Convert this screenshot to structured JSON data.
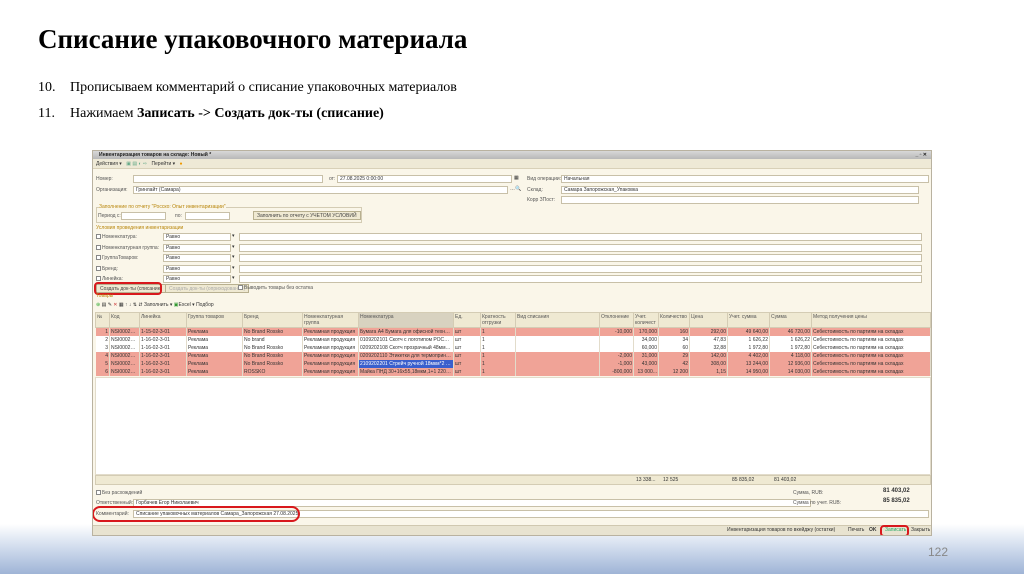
{
  "slide": {
    "title": "Списание упаковочного материала",
    "steps": [
      {
        "n": "10.",
        "text": "Прописываем комментарий о списание упаковочных материалов"
      },
      {
        "n": "11.",
        "pre": "Нажимаем ",
        "bold": "Записать -> Создать док-ты (списание)"
      }
    ],
    "page_number": "122"
  },
  "window": {
    "title": "Инвентаризация товаров на складе: Новый *",
    "toolbar": {
      "actions": "Действия",
      "goto": "Перейти"
    },
    "fields": {
      "number_label": "Номер:",
      "number_value": "",
      "date_label": "от:",
      "date_value": "27.08.2025 0:00:00",
      "org_label": "Организация:",
      "org_value": "Гринлайт (Самара)",
      "optype_label": "Вид операции:",
      "optype_value": "Начальная",
      "warehouse_label": "Склад:",
      "warehouse_value": "Самара Запорожская_Упаковка",
      "corr_label": "Корр ЗПост:",
      "corr_value": ""
    },
    "fill_group": {
      "title": "Заполнение по отчету \"Росско: Опыт инвентаризации\"",
      "period_from": "Период с:",
      "period_to": "по:",
      "fill_button": "Заполнить по отчету с УЧЕТОМ УСЛОВИЙ"
    },
    "conditions": {
      "title": "Условия проведения инвентаризации",
      "rows": [
        {
          "label": "Номенклатура:",
          "op": "Равно"
        },
        {
          "label": "Номенклатурная группа:",
          "op": "Равно"
        },
        {
          "label": "ГруппаТоваров:",
          "op": "Равно"
        },
        {
          "label": "Бренд:",
          "op": "Равно"
        },
        {
          "label": "Линейка:",
          "op": "Равно"
        }
      ]
    },
    "buttons": {
      "create_writeoff": "Создать док-ты (списание)",
      "create_receipt": "Создать док-ты (оприходование)",
      "no_stock": "Выводить товары без остатка"
    },
    "goods_label": "Товары",
    "table_toolbar": {
      "fill": "Заполнить",
      "excel": "Excel",
      "pick": "Подбор"
    },
    "columns": [
      "№",
      "Код",
      "Линейка",
      "Группа товаров",
      "Бренд",
      "Номенклатурная группа",
      "Номенклатура",
      "Ед.",
      "Кратность отгрузки",
      "Вид списания",
      "Отклонение",
      "Учет. количест",
      "Количество",
      "Цена",
      "Учет. сумма",
      "Сумма",
      "Метод получения цены"
    ],
    "rows": [
      {
        "style": "red",
        "cells": [
          "1",
          "NSI000270...",
          "1-15-02-3-01",
          "Реклама",
          "No Brand Rossko",
          "Рекламная продукция",
          "Бумага А4 Бумага для офисной техники...",
          "шт",
          "1",
          "",
          "-10,000",
          "170,000",
          "160",
          "292,00",
          "49 640,00",
          "46 720,00",
          "Себестоимость по партиям на складах"
        ]
      },
      {
        "style": "white",
        "cells": [
          "2",
          "NSI000237...",
          "1-16-02-3-01",
          "Реклама",
          "No brand",
          "Рекламная продукция",
          "0109202101 Скотч с логотипом РОССКО...",
          "шт",
          "1",
          "",
          "",
          "34,000",
          "34",
          "47,83",
          "1 626,22",
          "1 626,22",
          "Себестоимость по партиям на складах"
        ]
      },
      {
        "style": "white",
        "cells": [
          "3",
          "NSI000237...",
          "1-16-02-3-01",
          "Реклама",
          "No Brand Rossko",
          "Рекламная продукция",
          "0209202108 Скотч прозрачный 48мм*55...",
          "шт",
          "1",
          "",
          "",
          "60,000",
          "60",
          "32,88",
          "1 972,80",
          "1 972,80",
          "Себестоимость по партиям на складах"
        ]
      },
      {
        "style": "red",
        "cells": [
          "4",
          "NSI000237...",
          "1-16-02-3-01",
          "Реклама",
          "No Brand Rossko",
          "Рекламная продукция",
          "0209202110 Этикетки для термопринтер...",
          "шт",
          "1",
          "",
          "-2,000",
          "31,000",
          "29",
          "142,00",
          "4 402,00",
          "4 118,00",
          "Себестоимость по партиям на складах"
        ]
      },
      {
        "style": "red",
        "sel": true,
        "cells": [
          "5",
          "NSI000247...",
          "1-16-02-3-01",
          "Реклама",
          "No Brand Rossko",
          "Рекламная продукция",
          "2109202201 Стрейч ручной 18мкм*2 кг...",
          "шт",
          "1",
          "",
          "-1,000",
          "43,000",
          "42",
          "308,00",
          "13 244,00",
          "12 936,00",
          "Себестоимость по партиям на складах"
        ]
      },
      {
        "style": "red",
        "cells": [
          "6",
          "NSI000229...",
          "1-16-02-3-01",
          "Реклама",
          "ROSSKO",
          "Рекламная продукция",
          "Майка ПНД 30+16х55,18мкм,1+1 22072...",
          "шт",
          "1",
          "",
          "-800,000",
          "13 000...",
          "12 200",
          "1,15",
          "14 950,00",
          "14 030,00",
          "Себестоимость по партиям на складах"
        ]
      }
    ],
    "totals": {
      "acc_qty": "13 338...",
      "qty": "12 525",
      "acc_sum": "85 835,02",
      "sum": "81 403,02"
    },
    "no_diff": "Без расхождений",
    "responsible_label": "Ответственный:",
    "responsible_value": "Горбачев Егор Николаевич",
    "comment_label": "Комментарий:",
    "comment_value": "Списание упаковочных материалов Самара_Запорожская 27.08.2025",
    "sum_label": "Сумма, RUB:",
    "sum_value": "81 403,02",
    "acc_sum_label": "Сумма по учет. RUB:",
    "acc_sum_value": "85 835,02",
    "bottom": {
      "print_form": "Инвентаризация товаров по вкейджу (остатки)",
      "print": "Печать",
      "ok": "OK",
      "save": "Записать",
      "close": "Закрыть"
    }
  }
}
